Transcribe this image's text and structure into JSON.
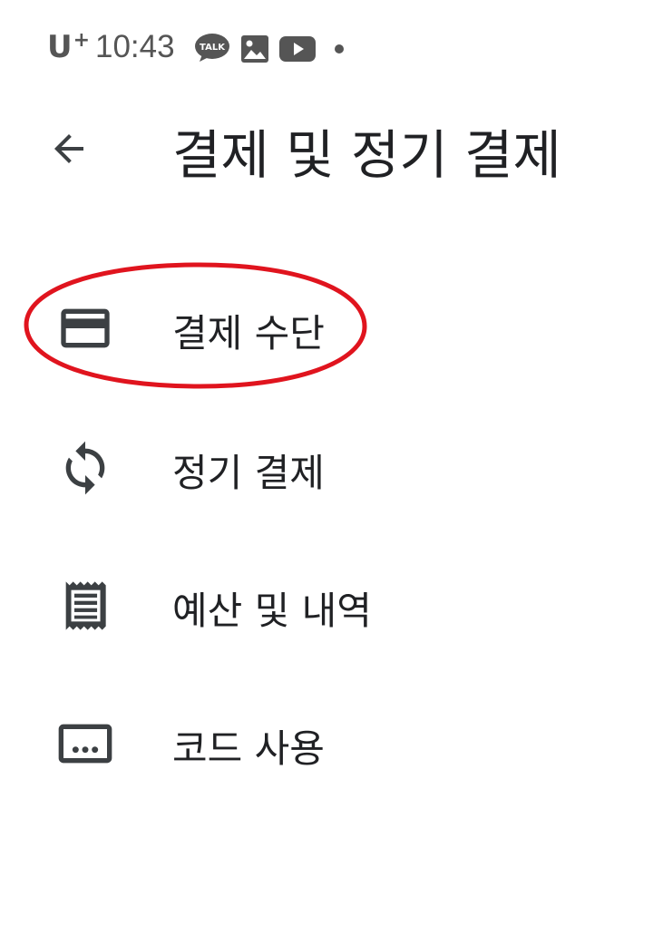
{
  "status_bar": {
    "carrier": "U",
    "carrier_plus": "+",
    "time": "10:43",
    "icons": [
      "kakaotalk-icon",
      "gallery-icon",
      "youtube-icon",
      "notification-dot-icon"
    ],
    "talk_label": "TALK"
  },
  "header": {
    "back_icon": "arrow-back-icon",
    "title": "결제 및 정기 결제"
  },
  "menu": {
    "items": [
      {
        "label": "결제 수단",
        "icon": "credit-card-icon",
        "highlighted": true
      },
      {
        "label": "정기 결제",
        "icon": "sync-icon"
      },
      {
        "label": "예산 및 내역",
        "icon": "receipt-icon"
      },
      {
        "label": "코드 사용",
        "icon": "redeem-code-icon"
      }
    ]
  },
  "colors": {
    "text": "#202124",
    "icon": "#3c4043",
    "status": "#555555",
    "highlight": "#e0141e",
    "background": "#ffffff"
  }
}
